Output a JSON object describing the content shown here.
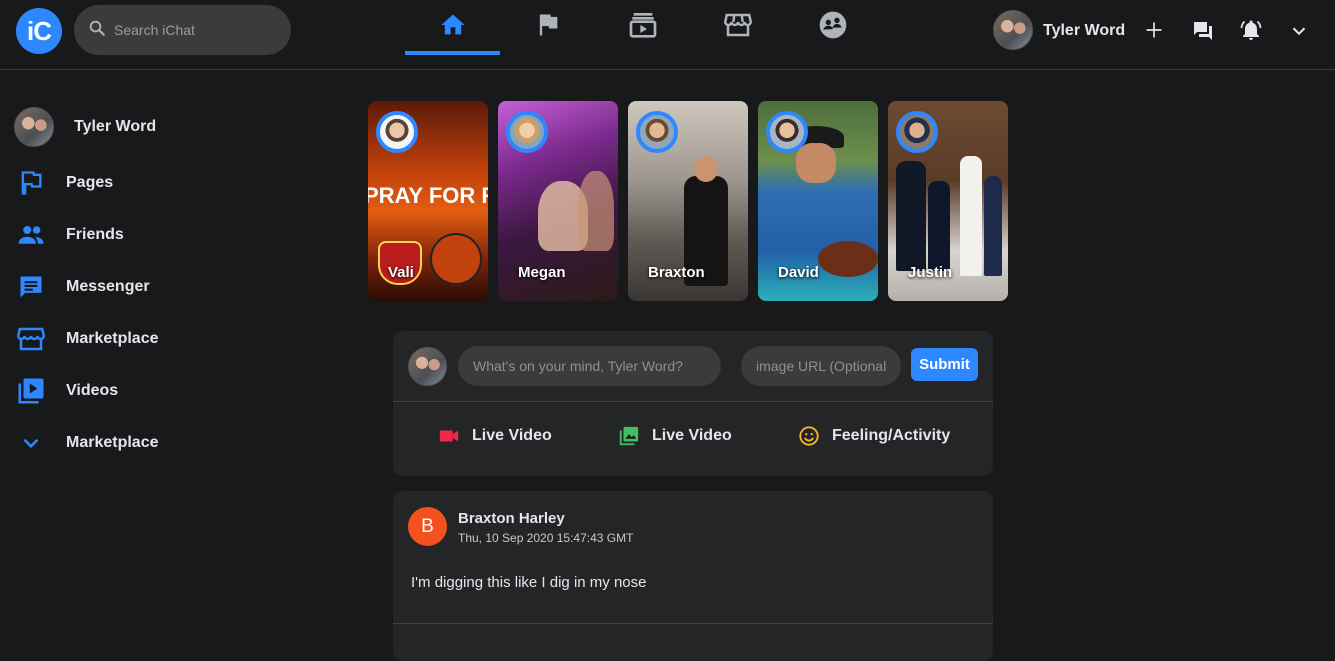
{
  "app": {
    "logo_text": "iC",
    "brand_color": "#2d88ff"
  },
  "header": {
    "search_placeholder": "Search iChat",
    "nav_icons": [
      "home-icon",
      "flag-icon",
      "subscriptions-icon",
      "storefront-icon",
      "groups-icon"
    ],
    "active_tab": "home",
    "user_name": "Tyler Word"
  },
  "sidebar": {
    "profile_name": "Tyler Word",
    "items": [
      {
        "label": "Pages",
        "icon": "pages-flag-icon"
      },
      {
        "label": "Friends",
        "icon": "people-icon"
      },
      {
        "label": "Messenger",
        "icon": "chat-icon"
      },
      {
        "label": "Marketplace",
        "icon": "storefront-icon"
      },
      {
        "label": "Videos",
        "icon": "video-library-icon"
      },
      {
        "label": "Marketplace",
        "icon": "chevron-down-icon"
      }
    ]
  },
  "stories": [
    {
      "name": "Vali",
      "overlay_text": "PRAY FOR REDDING,CA"
    },
    {
      "name": "Megan"
    },
    {
      "name": "Braxton"
    },
    {
      "name": "David"
    },
    {
      "name": "Justin"
    }
  ],
  "composer": {
    "message_placeholder": "What's on your mind, Tyler Word?",
    "image_placeholder": "image URL (Optional)",
    "submit_label": "Submit",
    "actions": [
      {
        "label": "Live Video",
        "icon": "videocam-icon",
        "color": "#f02849"
      },
      {
        "label": "Live Video",
        "icon": "photo-library-icon",
        "color": "#45bd62"
      },
      {
        "label": "Feeling/Activity",
        "icon": "smiley-icon",
        "color": "#f7b928"
      }
    ]
  },
  "post": {
    "avatar_letter": "B",
    "author": "Braxton Harley",
    "timestamp": "Thu, 10 Sep 2020 15:47:43 GMT",
    "text": "I'm digging this like I dig in my nose"
  }
}
